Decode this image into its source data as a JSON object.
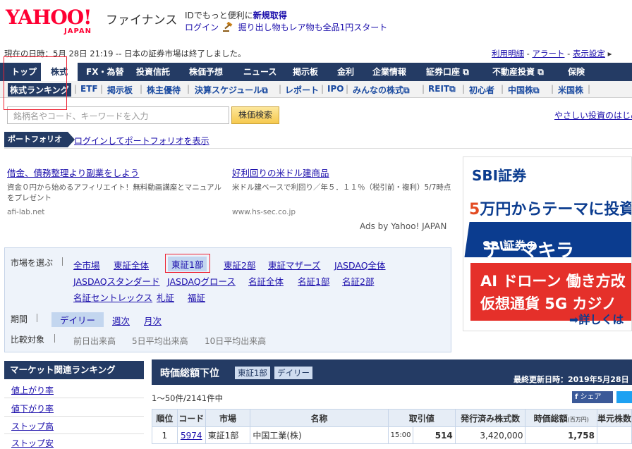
{
  "header": {
    "logo_text": "YAHOO!",
    "logo_sub": "JAPAN",
    "service_name": "ファイナンス",
    "id_prefix": "IDでもっと便利に",
    "register_link": "新規取得",
    "login_link": "ログイン",
    "promo_link": "掘り出し物もレア物も全品1円スタート"
  },
  "status_text": "現在の日時：5月 28日 21:19 -- 日本の証券市場は終了しました。",
  "top_links": [
    "利用明細",
    "アラート",
    "表示設定"
  ],
  "nav": {
    "items": [
      "トップ",
      "株式",
      "FX・為替",
      "投資信託",
      "株価予想",
      "ニュース",
      "掲示板",
      "金利",
      "企業情報",
      "証券口座",
      "不動産投資",
      "保険"
    ],
    "active": "株式"
  },
  "subnav": {
    "items": [
      "株式ランキング",
      "ETF",
      "掲示板",
      "株主優待",
      "決算スケジュール",
      "レポート",
      "IPO",
      "みんなの株式",
      "REIT",
      "初心者",
      "中国株",
      "米国株"
    ]
  },
  "search": {
    "placeholder": "銘柄名やコード、キーワードを入力",
    "button_label": "株価検索",
    "easy_link": "やさしい投資のはじめ方"
  },
  "portfolio": {
    "label": "ポートフォリオ",
    "login_link": "ログインしてポートフォリオを表示"
  },
  "ads": [
    {
      "title": "借金、債務整理より副業をしよう",
      "desc": "資金０円から始めるアフィリエイト！無料動画講座とマニュアルをプレゼント",
      "url": "afi-lab.net"
    },
    {
      "title": "好利回りの米ドル建商品",
      "desc": "米ドル建ベースで利回り／年５．１１％（税引前・複利）5/7時点",
      "url": "www.hs-sec.co.jp"
    }
  ],
  "ads_by": "Ads by Yahoo! JAPAN",
  "banner": {
    "brand": "SBI証券",
    "line1_num": "5",
    "line1": "万円からテーマに投資で",
    "line2": "SBI証券の",
    "line2_big": "テーマキラ",
    "red1": "AI ドローン 働き方改",
    "red2": "仮想通貨 5G カジノ",
    "more": "詳しくは"
  },
  "market": {
    "market_label": "市場を選ぶ",
    "markets_row1": [
      "全市場",
      "東証全体",
      "東証1部",
      "東証2部",
      "東証マザーズ",
      "JASDAQ全体"
    ],
    "markets_row2": [
      "JASDAQスタンダード",
      "JASDAQグロース",
      "名証全体",
      "名証1部",
      "名証2部"
    ],
    "markets_row3": [
      "名証セントレックス",
      "札証",
      "福証"
    ],
    "period_label": "期間",
    "periods": [
      "デイリー",
      "週次",
      "月次"
    ],
    "compare_label": "比較対象",
    "compares": [
      "前日出来高",
      "5日平均出来高",
      "10日平均出来高"
    ]
  },
  "side": {
    "title": "マーケット関連ランキング",
    "items": [
      "値上がり率",
      "値下がり率",
      "ストップ高",
      "ストップ安"
    ]
  },
  "ranking": {
    "title": "時価総額下位",
    "badge_market": "東証1部",
    "badge_period": "デイリー",
    "updated": "最終更新日時：2019年5月28日",
    "count": "1〜50件/2141件中",
    "share": "シェア",
    "columns": [
      "順位",
      "コード",
      "市場",
      "名称",
      "取引値",
      "発行済み株式数",
      "時価総額",
      "(百万円)",
      "単元株数"
    ],
    "rows": [
      {
        "rank": "1",
        "code": "5974",
        "market": "東証1部",
        "name": "中国工業(株)",
        "time": "15:00",
        "price": "514",
        "shares": "3,420,000",
        "cap": "1,758"
      }
    ]
  },
  "colors": {
    "nav_bg": "#243b64",
    "link": "#1a0dab",
    "highlight": "#e22233"
  }
}
